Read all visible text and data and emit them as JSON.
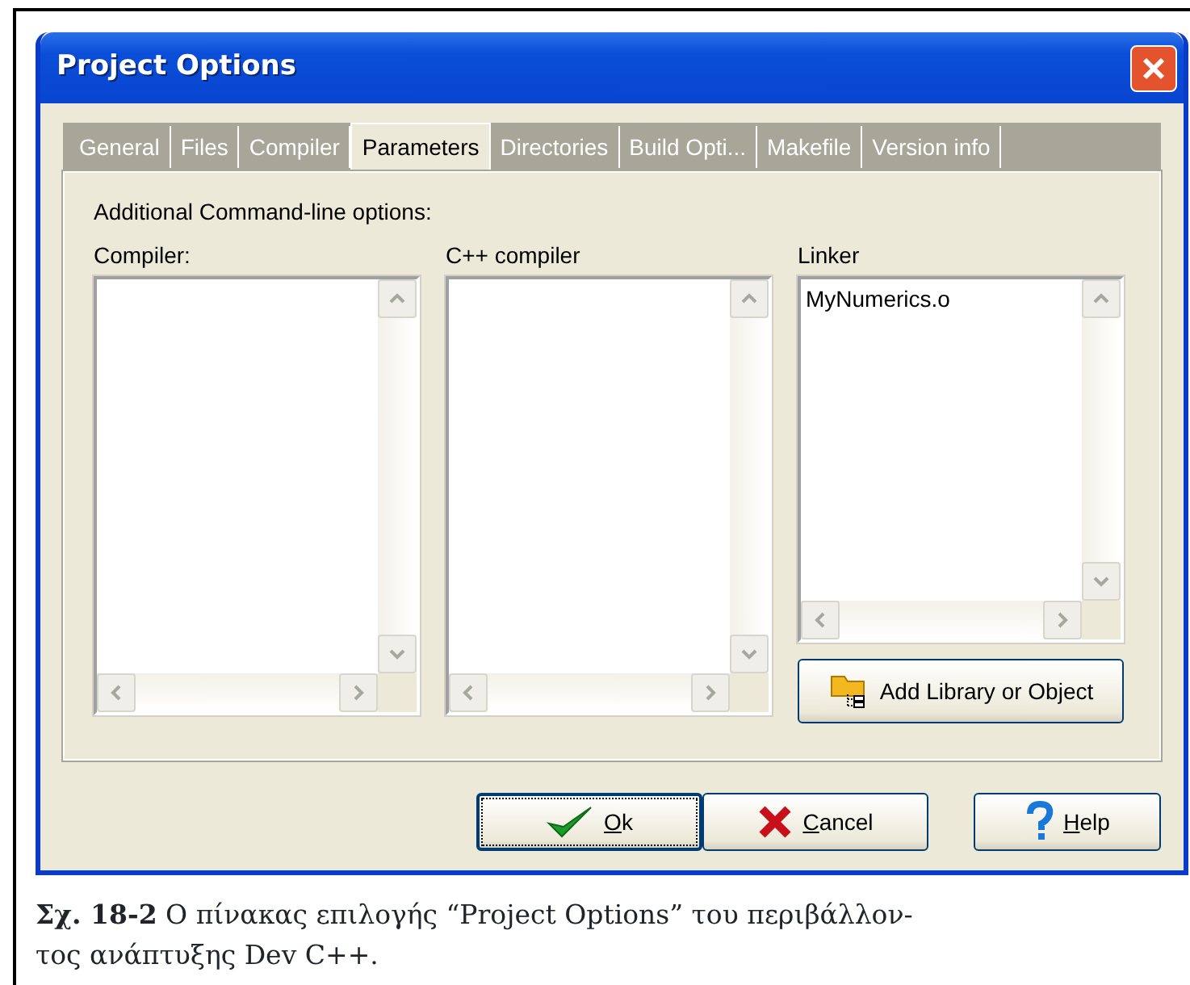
{
  "window": {
    "title": "Project Options"
  },
  "tabs": [
    {
      "label": "General",
      "selected": false
    },
    {
      "label": "Files",
      "selected": false
    },
    {
      "label": "Compiler",
      "selected": false
    },
    {
      "label": "Parameters",
      "selected": true
    },
    {
      "label": "Directories",
      "selected": false
    },
    {
      "label": "Build Opti...",
      "selected": false
    },
    {
      "label": "Makefile",
      "selected": false
    },
    {
      "label": "Version info",
      "selected": false
    }
  ],
  "heading": "Additional Command-line options:",
  "columns": [
    {
      "label": "Compiler:"
    },
    {
      "label": "C++ compiler"
    },
    {
      "label": "Linker",
      "lines": [
        "MyNumerics.o"
      ],
      "add_button": "Add Library or Object"
    }
  ],
  "buttons": [
    {
      "kind": "ok",
      "label": "Ok",
      "focused": true
    },
    {
      "kind": "cancel",
      "label": "Cancel",
      "focused": false
    },
    {
      "kind": "help",
      "label": "Help",
      "focused": false
    }
  ],
  "caption": [
    "**Σχ. 18-2**  Ο πίνακας επιλογής “Project Options” του περιβάλλον-",
    "τος ανάπτυξης Dev C++."
  ]
}
